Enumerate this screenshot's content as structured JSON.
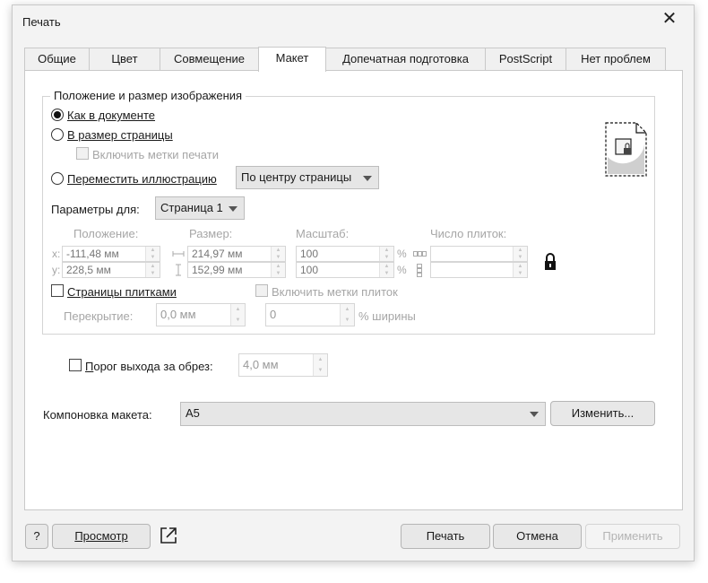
{
  "window": {
    "title": "Печать"
  },
  "tabs": [
    "Общие",
    "Цвет",
    "Совмещение",
    "Макет",
    "Допечатная подготовка",
    "PostScript",
    "Нет проблем"
  ],
  "position_group": {
    "legend": "Положение и размер изображения",
    "radio_as_document": "Как в документе",
    "radio_fit_page": "В размер страницы",
    "include_print_marks": "Включить метки печати",
    "radio_move": "Переместить иллюстрацию",
    "move_select": "По центру страницы",
    "params_label": "Параметры для:",
    "params_select": "Страница 1",
    "col_position": "Положение:",
    "col_size": "Размер:",
    "col_scale": "Масштаб:",
    "col_tiles": "Число плиток:",
    "x_label": "x:",
    "y_label": "y:",
    "x_value": "-111,48 мм",
    "y_value": "228,5 мм",
    "width_value": "214,97 мм",
    "height_value": "152,99 мм",
    "scale_x": "100",
    "scale_y": "100",
    "percent": "%",
    "tile_pages": "Страницы плитками",
    "include_tile_marks": "Включить метки плиток",
    "overlap_label": "Перекрытие:",
    "overlap_value": "0,0 мм",
    "overlap_pct": "0",
    "pct_width": "% ширины"
  },
  "bleed": {
    "label": "Порог выхода за обрез:",
    "value": "4,0 мм"
  },
  "layout": {
    "label": "Компоновка макета:",
    "value": "A5",
    "change_button": "Изменить..."
  },
  "footer": {
    "help": "?",
    "preview": "Просмотр",
    "print": "Печать",
    "cancel": "Отмена",
    "apply": "Применить"
  }
}
